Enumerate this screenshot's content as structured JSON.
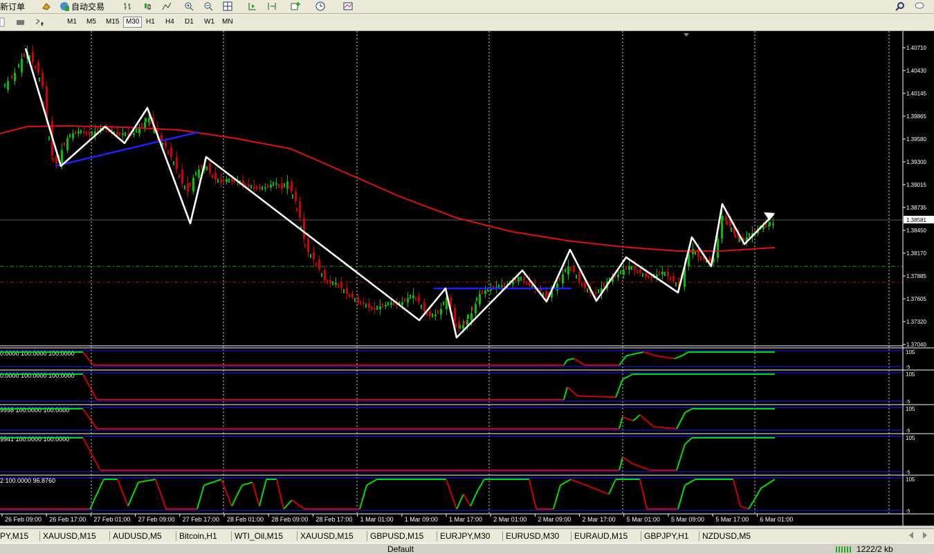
{
  "toolbar": {
    "new_order_label": "新订单",
    "auto_trading_label": "自动交易"
  },
  "timeframes": [
    "M1",
    "M5",
    "M15",
    "M30",
    "H1",
    "H4",
    "D1",
    "W1",
    "MN"
  ],
  "active_timeframe": "M30",
  "chart": {
    "current_price": "1.38581",
    "price_labels": [
      "1.40710",
      "1.40430",
      "1.40145",
      "1.39865",
      "1.39580",
      "1.39300",
      "1.39015",
      "1.38735",
      "1.38450",
      "1.38170",
      "1.37885",
      "1.37605",
      "1.37320",
      "1.37040"
    ],
    "time_labels": [
      "26 Feb 09:00",
      "26 Feb 17:00",
      "27 Feb 01:00",
      "27 Feb 09:00",
      "27 Feb 17:00",
      "28 Feb 01:00",
      "28 Feb 09:00",
      "28 Feb 17:00",
      "1 Mar 01:00",
      "1 Mar 09:00",
      "1 Mar 17:00",
      "2 Mar 01:00",
      "2 Mar 09:00",
      "2 Mar 17:00",
      "5 Mar 01:00",
      "5 Mar 09:00",
      "5 Mar 17:00",
      "6 Mar 01:00"
    ],
    "colors": {
      "bull": "#00c000",
      "bear": "#d00000",
      "ma": "#e01010",
      "zigzag": "#ffffff",
      "trend": "#2020ff",
      "grid": "#ffffff",
      "signal": "#00e000"
    }
  },
  "indicators": [
    {
      "label": "0.0000 100.0000 100.0000",
      "level_top": "105",
      "level_bottom": "-5"
    },
    {
      "label": "0.0000 100.0000 100.0000",
      "level_top": "105",
      "level_bottom": "-5"
    },
    {
      "label": "9998 100.0000 100.0000",
      "level_top": "105",
      "level_bottom": "-5"
    },
    {
      "label": "9941 100.0000 100.0000",
      "level_top": "105",
      "level_bottom": "-5"
    },
    {
      "label": "2 100.0000 96.8760",
      "level_top": "105",
      "level_bottom": "-5"
    }
  ],
  "symbol_tabs": [
    "PY,M15",
    "XAUUSD,M15",
    "AUDUSD,M5",
    "Bitcoin,H1",
    "WTI_Oil,M15",
    "XAUUSD,M15",
    "GBPUSD,M15",
    "EURJPY,M30",
    "EURUSD,M30",
    "EURAUD,M15",
    "GBPJPY,H1",
    "NZDUSD,M5"
  ],
  "status": {
    "profile": "Default",
    "traffic": "1222/2 kb"
  }
}
